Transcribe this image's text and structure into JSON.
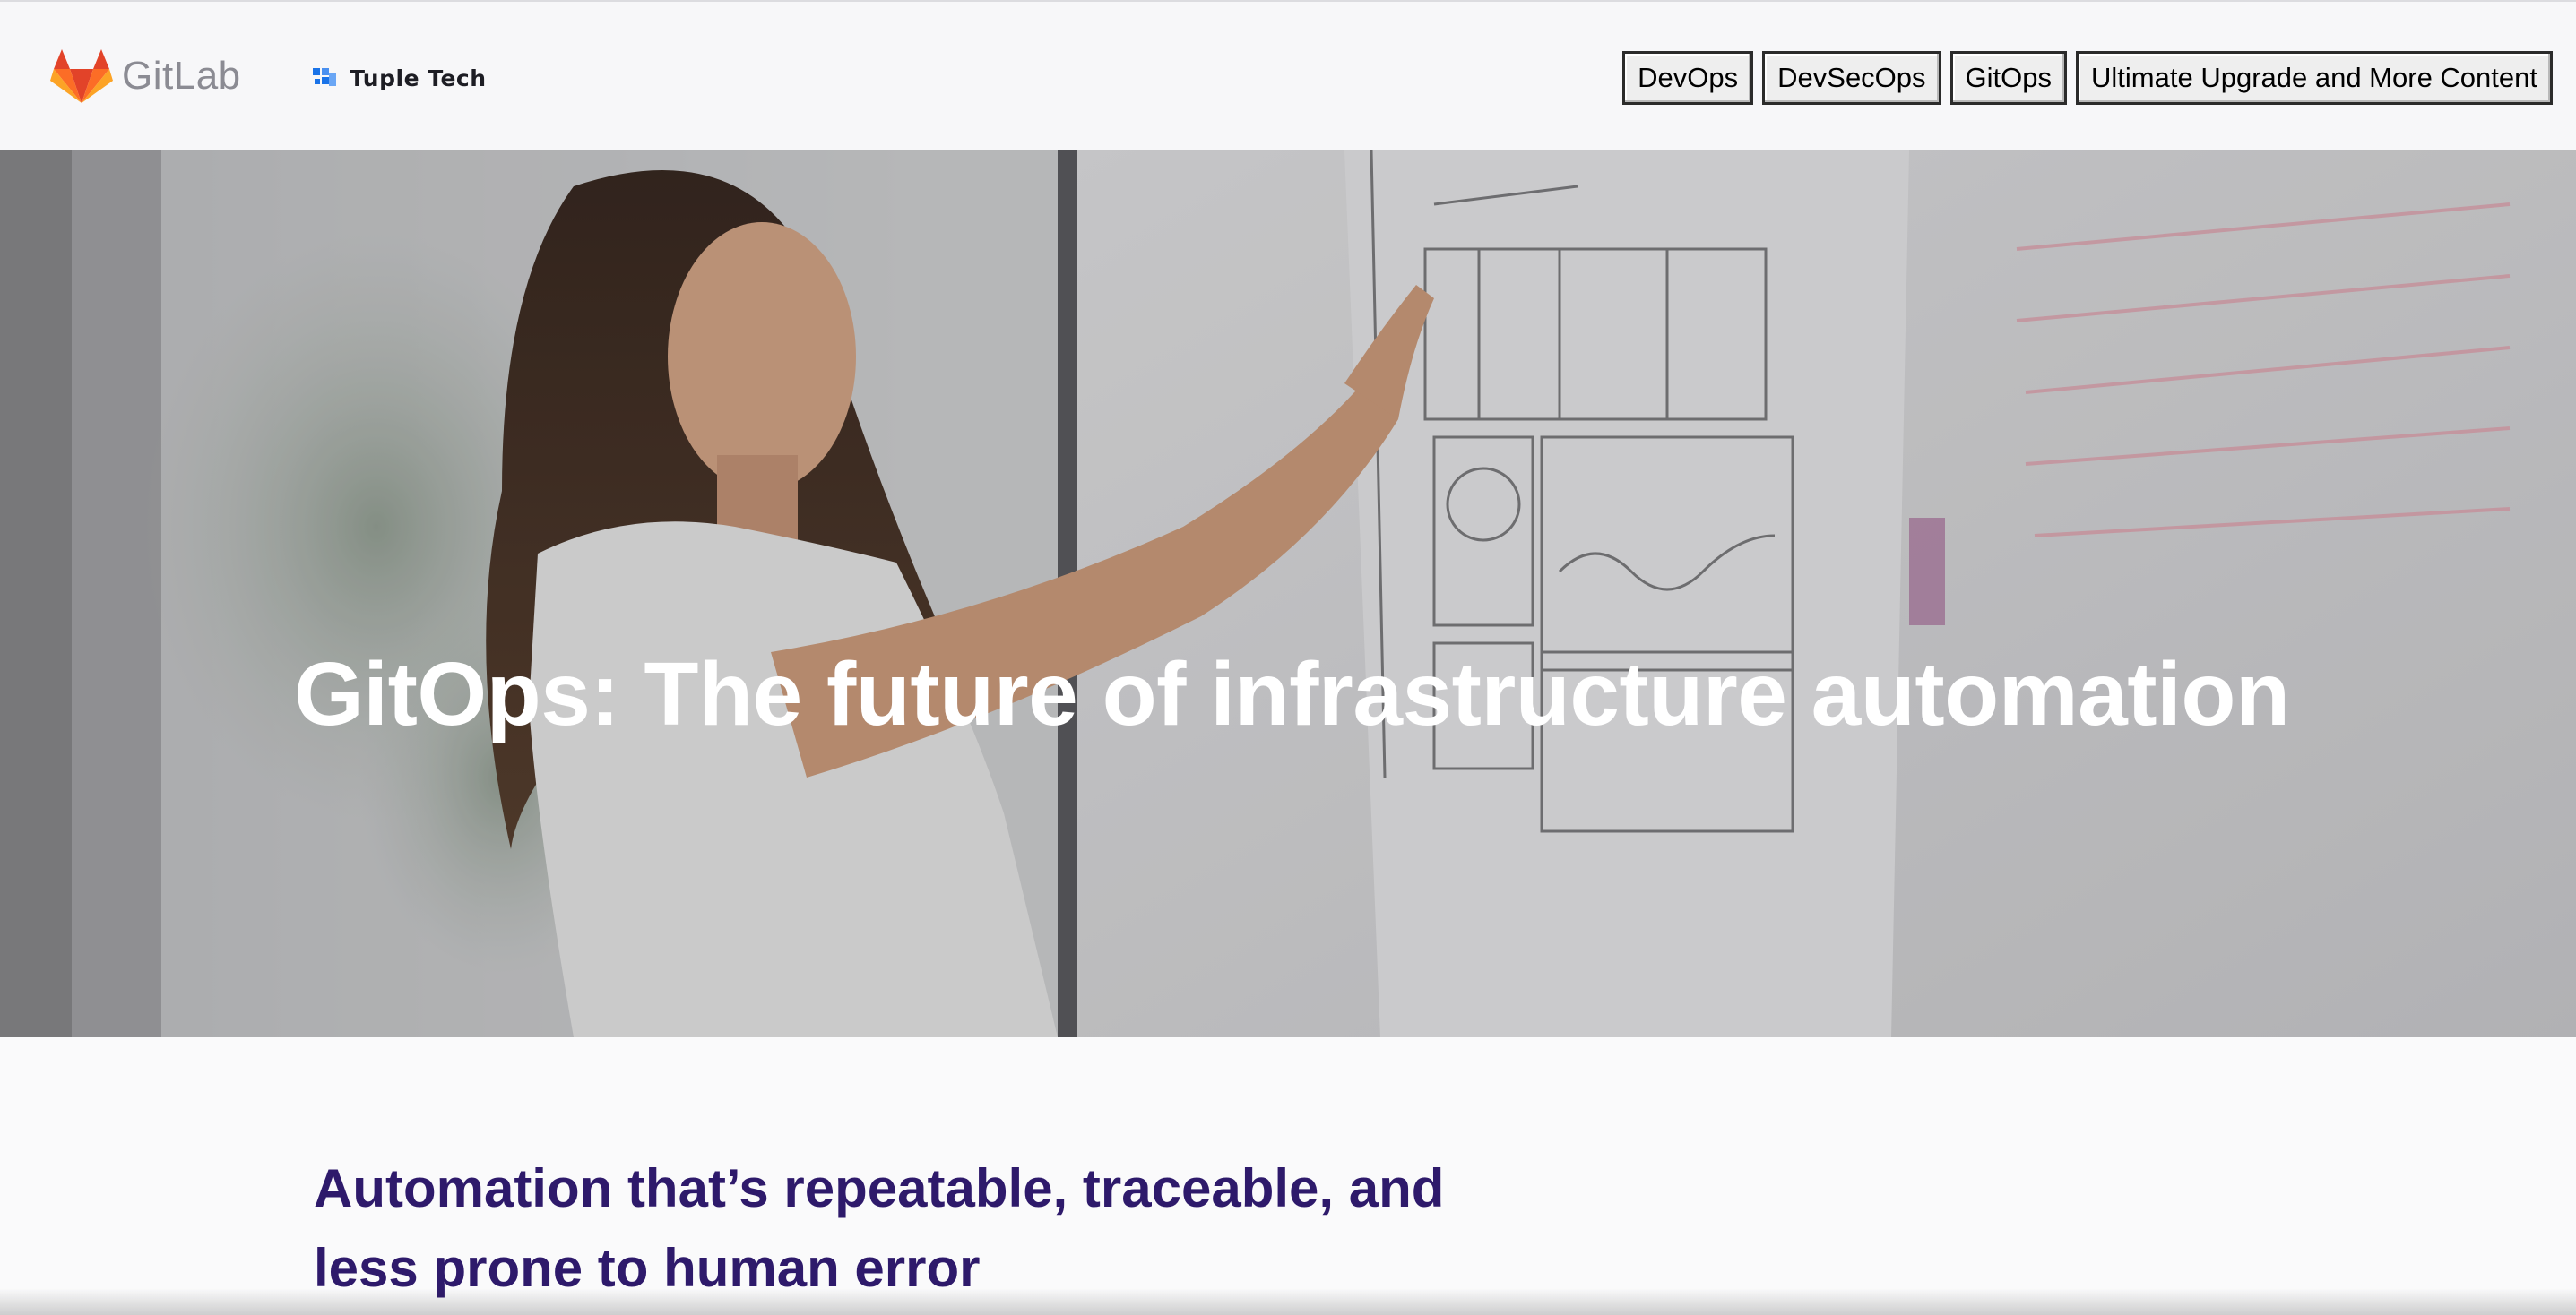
{
  "header": {
    "logo_icon": "gitlab-tanuki-icon",
    "logo_text": "GitLab",
    "partner_icon": "tuple-tech-icon",
    "partner_name": "Tuple Tech"
  },
  "nav": {
    "items": [
      {
        "label": "DevOps"
      },
      {
        "label": "DevSecOps"
      },
      {
        "label": "GitOps"
      },
      {
        "label": "Ultimate Upgrade and More Content"
      }
    ]
  },
  "hero": {
    "title": "GitOps: The future of infrastructure automation"
  },
  "intro": {
    "heading_line1": "Automation that’s repeatable, traceable, and",
    "heading_line2": "less prone to human error"
  },
  "colors": {
    "brand_orange": "#e24329",
    "intro_text": "#2e1a6b",
    "partner_blue": "#1a73e8"
  }
}
